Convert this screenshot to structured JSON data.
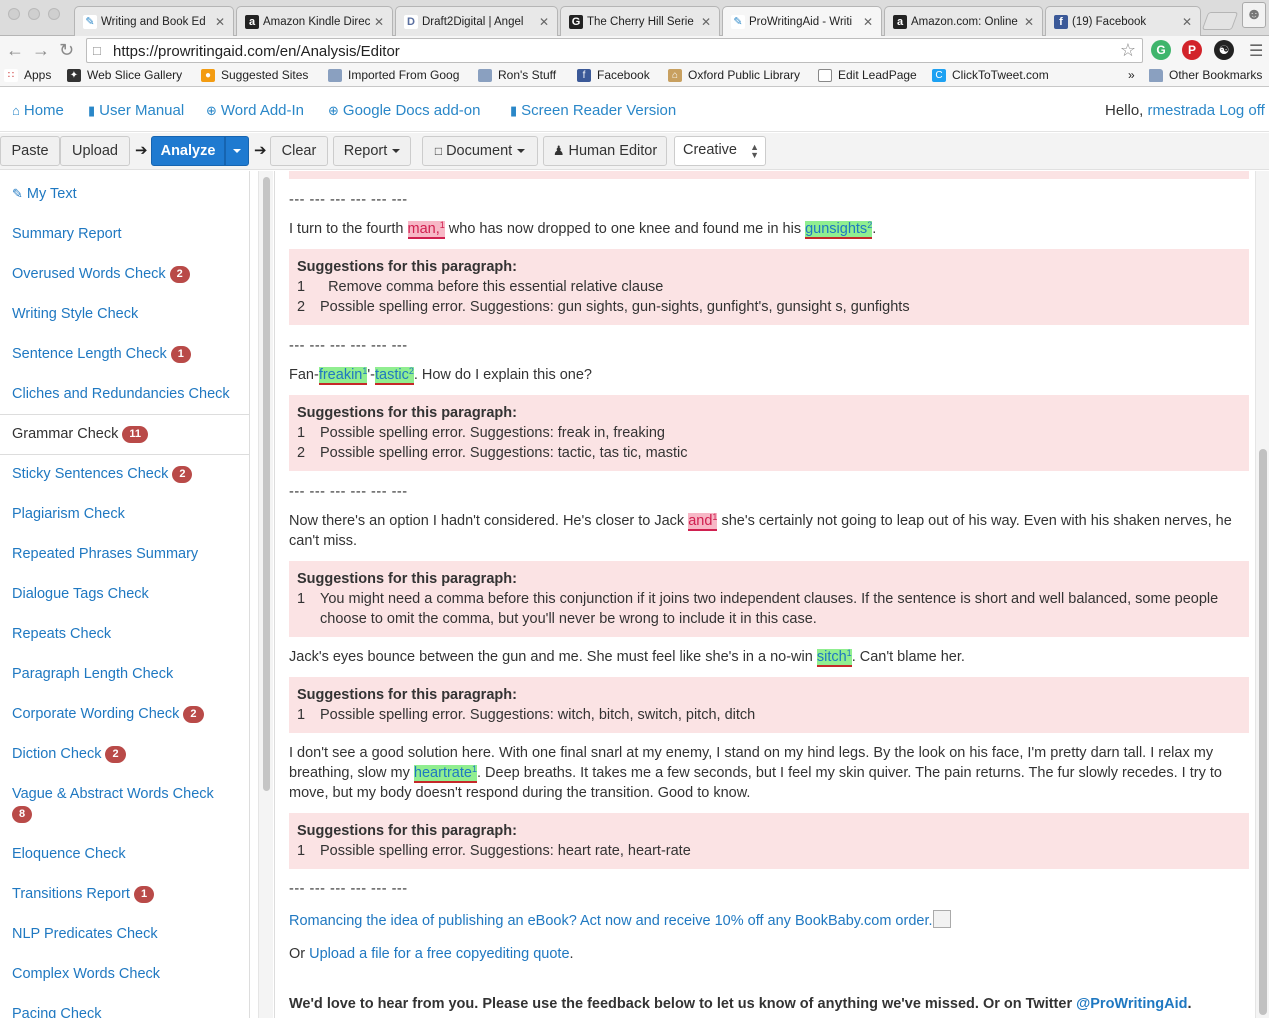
{
  "browser": {
    "tabs": [
      {
        "title": "Writing and Book Ed",
        "favicon": "pwa-icon",
        "active": false
      },
      {
        "title": "Amazon Kindle Direc",
        "favicon": "amazon-icon",
        "active": false
      },
      {
        "title": "Draft2Digital | Angel",
        "favicon": "d2d-icon",
        "active": false
      },
      {
        "title": "The Cherry Hill Serie",
        "favicon": "goodreads-icon",
        "active": false
      },
      {
        "title": "ProWritingAid - Writi",
        "favicon": "pwa-icon",
        "active": true
      },
      {
        "title": "Amazon.com: Online",
        "favicon": "amazon-icon",
        "active": false
      },
      {
        "title": "(19) Facebook",
        "favicon": "facebook-icon",
        "active": false
      }
    ],
    "url": "https://prowritingaid.com/en/Analysis/Editor",
    "bookmarks": [
      {
        "label": "Apps",
        "icon": "apps-grid-icon"
      },
      {
        "label": "Web Slice Gallery",
        "icon": "web-slice-icon"
      },
      {
        "label": "Suggested Sites",
        "icon": "suggested-sites-icon"
      },
      {
        "label": "Imported From Goog",
        "icon": "folder-icon"
      },
      {
        "label": "Ron's Stuff",
        "icon": "folder-icon"
      },
      {
        "label": "Facebook",
        "icon": "facebook-icon"
      },
      {
        "label": "Oxford Public Library",
        "icon": "library-icon"
      },
      {
        "label": "Edit LeadPage",
        "icon": "page-icon"
      },
      {
        "label": "ClickToTweet.com",
        "icon": "clicktotweet-icon"
      }
    ],
    "other_bookmarks": "Other Bookmarks",
    "overflow": "»"
  },
  "appnav": {
    "home": "Home",
    "manual": "User Manual",
    "word": "Word Add-In",
    "gdocs": "Google Docs add-on",
    "reader": "Screen Reader Version",
    "hello": "Hello,",
    "user": "rmestrada",
    "logoff": "Log off"
  },
  "toolbar": {
    "paste": "Paste",
    "upload": "Upload",
    "analyze": "Analyze",
    "clear": "Clear",
    "report": "Report",
    "document": "Document",
    "human_editor": "Human Editor",
    "style_selected": "Creative"
  },
  "sidebar": [
    {
      "label": "My Text",
      "icon": "edit-icon"
    },
    {
      "label": "Summary Report"
    },
    {
      "label": "Overused Words Check",
      "badge": "2"
    },
    {
      "label": "Writing Style Check"
    },
    {
      "label": "Sentence Length Check",
      "badge": "1"
    },
    {
      "label": "Cliches and Redundancies Check"
    },
    {
      "label": "Grammar Check",
      "badge": "11",
      "current": true
    },
    {
      "label": "Sticky Sentences Check",
      "badge": "2"
    },
    {
      "label": "Plagiarism Check"
    },
    {
      "label": "Repeated Phrases Summary"
    },
    {
      "label": "Dialogue Tags Check"
    },
    {
      "label": "Repeats Check"
    },
    {
      "label": "Paragraph Length Check"
    },
    {
      "label": "Corporate Wording Check",
      "badge": "2"
    },
    {
      "label": "Diction Check",
      "badge": "2"
    },
    {
      "label": "Vague & Abstract Words Check",
      "badge": "8"
    },
    {
      "label": "Eloquence Check"
    },
    {
      "label": "Transitions Report",
      "badge": "1"
    },
    {
      "label": "NLP Predicates Check"
    },
    {
      "label": "Complex Words Check"
    },
    {
      "label": "Pacing Check"
    }
  ],
  "content": {
    "separator": "--- --- --- --- --- ---",
    "sugg_heading": "Suggestions for this paragraph:",
    "p1": {
      "a": "I turn to the fourth ",
      "h1": "man,",
      "h1sup": "1",
      "b": " who has now dropped to one knee and found me in his ",
      "h2": "gunsights",
      "h2sup": "2",
      "c": "."
    },
    "s1": [
      {
        "n": "1",
        "t": "  Remove comma before this essential relative clause"
      },
      {
        "n": "2",
        "t": "Possible spelling error. Suggestions: gun sights, gun-sights, gunfight's, gunsight s, gunfights"
      }
    ],
    "p2": {
      "a": "Fan-",
      "h1": "freakin",
      "h1sup": "1",
      "b": "'-",
      "h2": "tastic",
      "h2sup": "2",
      "c": ". How do I explain this one?"
    },
    "s2": [
      {
        "n": "1",
        "t": "Possible spelling error. Suggestions: freak in, freaking"
      },
      {
        "n": "2",
        "t": "Possible spelling error. Suggestions: tactic, tas tic, mastic"
      }
    ],
    "p3": {
      "a": "Now there's an option I hadn't considered. He's closer to Jack ",
      "h1": "and",
      "h1sup": "1",
      "b": " she's certainly not going to leap out of his way. Even with his shaken nerves, he can't miss."
    },
    "s3": [
      {
        "n": "1",
        "t": "You might need a comma before this conjunction if it joins two independent clauses. If the sentence is short and well balanced, some people choose to omit the comma, but you'll never be wrong to include it in this case."
      }
    ],
    "p4": {
      "a": "Jack's eyes bounce between the gun and me. She must feel like she's in a no-win ",
      "h1": "sitch",
      "h1sup": "1",
      "b": ". Can't blame her."
    },
    "s4": [
      {
        "n": "1",
        "t": "Possible spelling error. Suggestions: witch, bitch, switch, pitch, ditch"
      }
    ],
    "p5": {
      "a": "I don't see a good solution here. With one final snarl at my enemy, I stand on my hind legs. By the look on his face, I'm pretty darn tall. I relax my breathing, slow my ",
      "h1": "heartrate",
      "h1sup": "1",
      "b": ". Deep breaths. It takes me a few seconds, but I feel my skin quiver. The pain returns. The fur slowly recedes. I try to move, but my body doesn't respond during the transition. Good to know."
    },
    "s5": [
      {
        "n": "1",
        "t": "Possible spelling error. Suggestions: heart rate, heart-rate"
      }
    ],
    "promo": "Romancing the idea of publishing an eBook? Act now and receive 10% off any BookBaby.com order.",
    "quote_prefix": "Or ",
    "quote_link": "Upload a file for a free copyediting quote",
    "quote_suffix": ".",
    "feedback": "We'd love to hear from you. Please use the feedback below to let us know of anything we've missed. Or on Twitter ",
    "twitter": "@ProWritingAid",
    "feedback_end": "."
  }
}
